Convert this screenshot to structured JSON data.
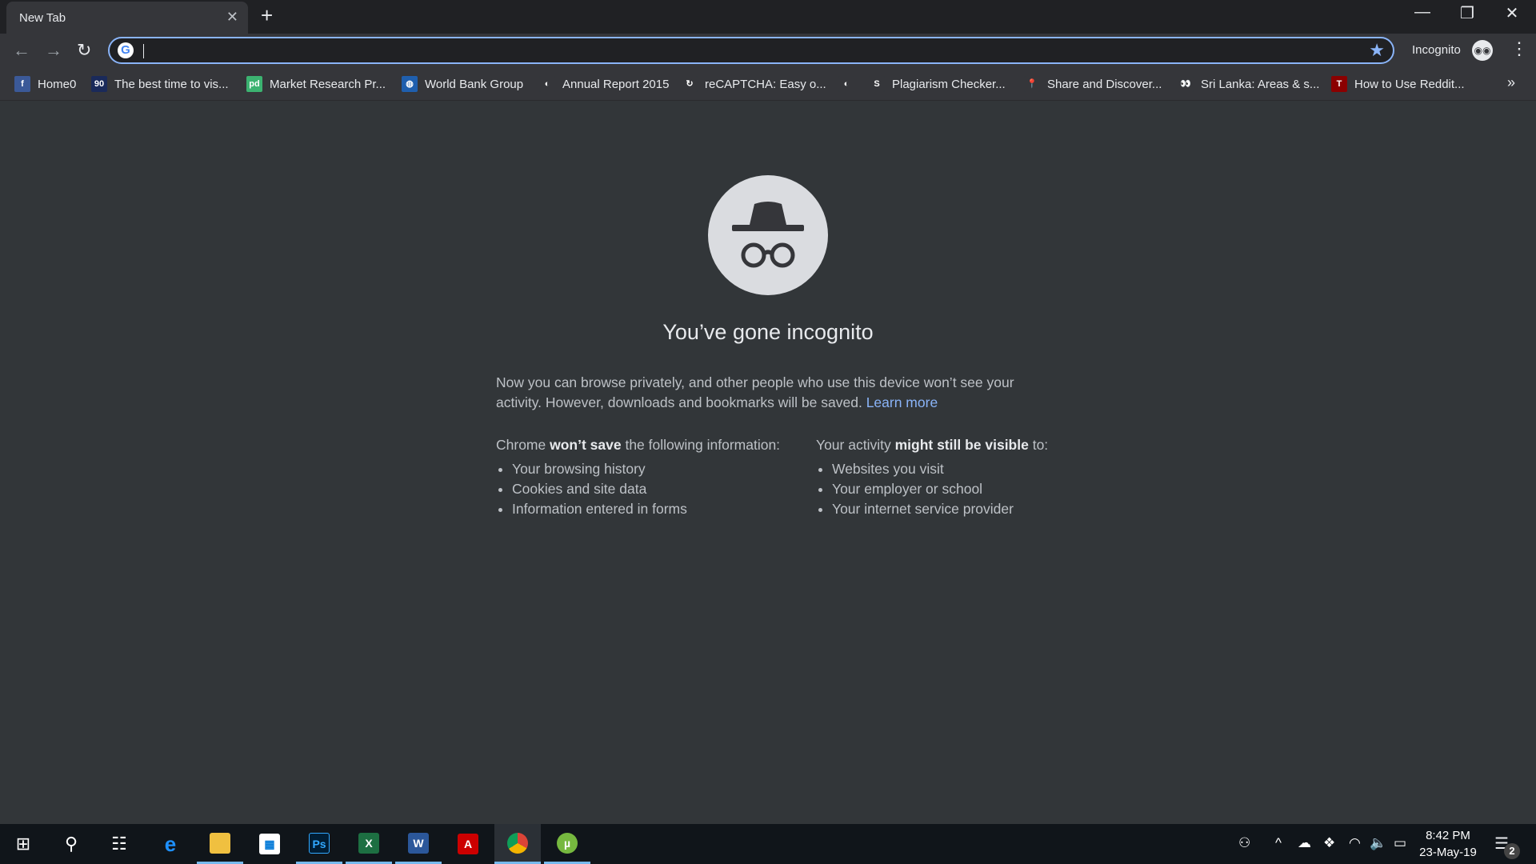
{
  "tab": {
    "title": "New Tab",
    "close": "✕",
    "new_tab": "+"
  },
  "window": {
    "minimize": "—",
    "restore": "❐",
    "close": "✕"
  },
  "toolbar": {
    "back": "←",
    "forward": "→",
    "reload": "↻",
    "omnibox_value": "",
    "google_icon": "G",
    "star": "★",
    "profile_label": "Incognito",
    "menu": "⋮"
  },
  "bookmarks": [
    {
      "label": "Home0",
      "icon": "facebook-icon",
      "color": "#3b5998",
      "glyph": "f"
    },
    {
      "label": "The best time to vis...",
      "icon": "site-90-icon",
      "color": "#1a2a5a",
      "glyph": "90"
    },
    {
      "label": "Market Research Pr...",
      "icon": "pd-icon",
      "color": "#3cb371",
      "glyph": "pd"
    },
    {
      "label": "World Bank Group",
      "icon": "globe-icon",
      "color": "#1f5fae",
      "glyph": "◍"
    },
    {
      "label": "Annual Report 2015",
      "icon": "world-icon",
      "color": "#35363a",
      "glyph": "◐"
    },
    {
      "label": "reCAPTCHA: Easy o...",
      "icon": "recaptcha-icon",
      "color": "#35363a",
      "glyph": "↻"
    },
    {
      "label": "",
      "icon": "world-icon",
      "color": "#35363a",
      "glyph": "◐"
    },
    {
      "label": "Plagiarism Checker...",
      "icon": "plagiarism-icon",
      "color": "#35363a",
      "glyph": "S"
    },
    {
      "label": "Share and Discover...",
      "icon": "location-pin-icon",
      "color": "#35363a",
      "glyph": "📍"
    },
    {
      "label": "Sri Lanka: Areas & s...",
      "icon": "tripadvisor-icon",
      "color": "#35363a",
      "glyph": "👀"
    },
    {
      "label": "How to Use Reddit...",
      "icon": "t-icon",
      "color": "#8b0000",
      "glyph": "T"
    }
  ],
  "bookmarks_more": "»",
  "page": {
    "heading": "You’ve gone incognito",
    "desc": "Now you can browse privately, and other people who use this device won’t see your activity. However, downloads and bookmarks will be saved.",
    "learn_more": "Learn more",
    "left": {
      "pre": "Chrome ",
      "bold": "won’t save",
      "post": " the following information:",
      "items": [
        "Your browsing history",
        "Cookies and site data",
        "Information entered in forms"
      ]
    },
    "right": {
      "pre": "Your activity ",
      "bold": "might still be visible",
      "post": " to:",
      "items": [
        "Websites you visit",
        "Your employer or school",
        "Your internet service provider"
      ]
    }
  },
  "taskbar": {
    "time": "8:42 PM",
    "date": "23-May-19",
    "notifications": "2"
  }
}
